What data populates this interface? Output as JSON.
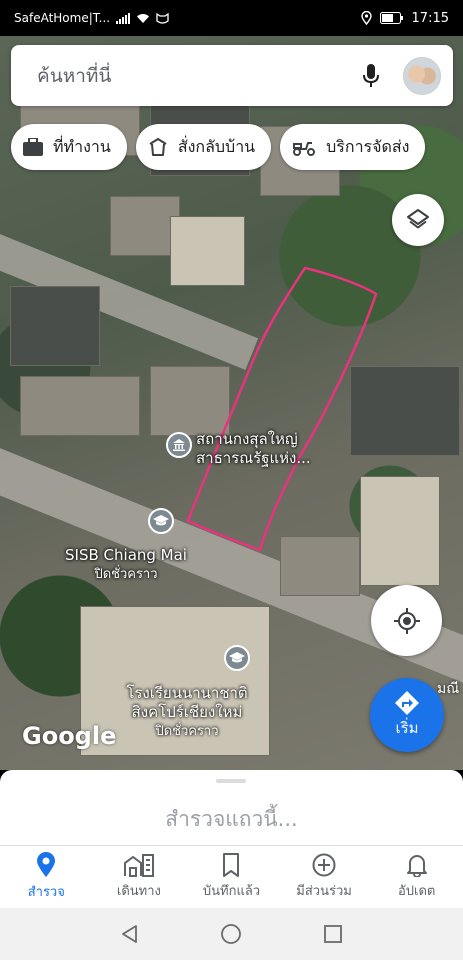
{
  "status_bar": {
    "carrier": "SafeAtHome|T...",
    "time": "17:15"
  },
  "search": {
    "placeholder": "ค้นหาที่นี่"
  },
  "chips": [
    {
      "icon": "briefcase-icon",
      "label": "ที่ทำงาน"
    },
    {
      "icon": "takeout-icon",
      "label": "สั่งกลับบ้าน"
    },
    {
      "icon": "delivery-scooter-icon",
      "label": "บริการจัดส่ง"
    }
  ],
  "map": {
    "pins": [
      {
        "icon": "government-building-icon",
        "line1": "สถานกงสุลใหญ่",
        "line2": "สาธารณรัฐแห่ง..."
      },
      {
        "icon": "school-icon",
        "line1": "SISB Chiang Mai",
        "line2": "ปิดชั่วคราว"
      },
      {
        "icon": "school-icon",
        "line1": "โรงเรียนนานาชาติ",
        "line2": "สิงคโปร์เชียงใหม่",
        "line3": "ปิดชั่วคราว"
      }
    ],
    "edge_label": "มณี",
    "logo": "Google",
    "plot_outline_color": "#e8337d"
  },
  "go_button": {
    "label": "เริ่ม"
  },
  "explore": {
    "text": "สำรวจแถวนี้..."
  },
  "bottom_nav": [
    {
      "icon": "place-pin-icon",
      "label": "สำรวจ",
      "active": true
    },
    {
      "icon": "commute-icon",
      "label": "เดินทาง",
      "active": false
    },
    {
      "icon": "bookmark-icon",
      "label": "บันทึกแล้ว",
      "active": false
    },
    {
      "icon": "add-circle-icon",
      "label": "มีส่วนร่วม",
      "active": false
    },
    {
      "icon": "bell-icon",
      "label": "อัปเดต",
      "active": false
    }
  ],
  "colors": {
    "accent": "#1a73e8",
    "plot_outline": "#e8337d"
  }
}
